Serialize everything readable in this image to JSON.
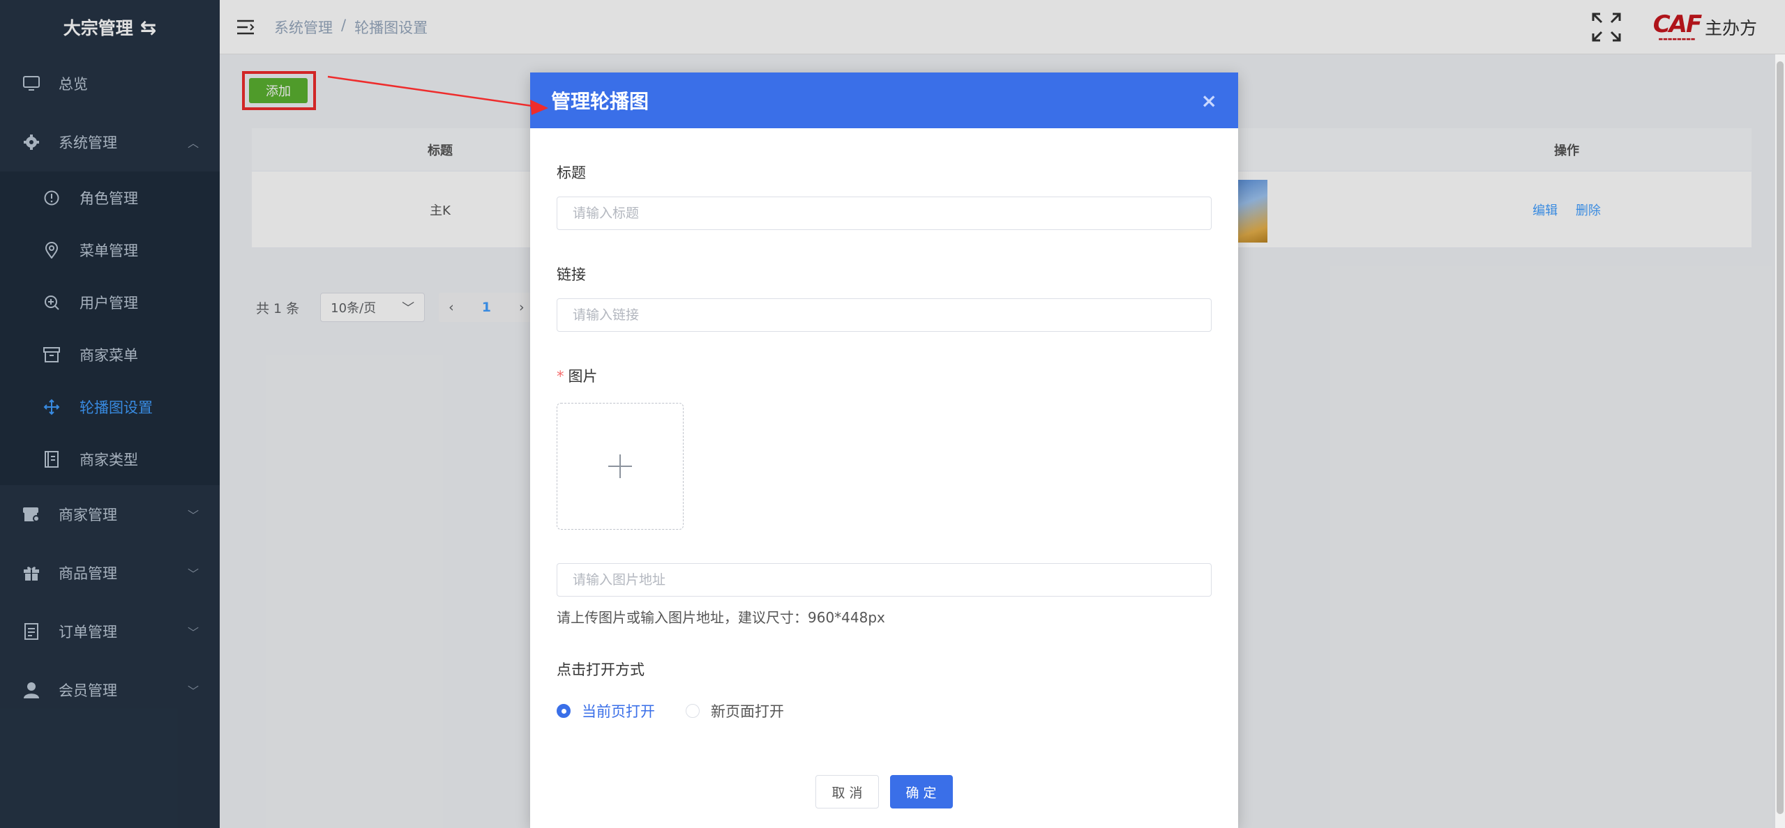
{
  "sidebar": {
    "logo_title": "大宗管理",
    "items": [
      {
        "label": "总览"
      },
      {
        "label": "系统管理"
      },
      {
        "label": "商家管理"
      },
      {
        "label": "商品管理"
      },
      {
        "label": "订单管理"
      },
      {
        "label": "会员管理"
      }
    ],
    "sub_items": [
      {
        "label": "角色管理"
      },
      {
        "label": "菜单管理"
      },
      {
        "label": "用户管理"
      },
      {
        "label": "商家菜单"
      },
      {
        "label": "轮播图设置"
      },
      {
        "label": "商家类型"
      }
    ],
    "active_color": "#409eff"
  },
  "header": {
    "breadcrumb": [
      "系统管理",
      "/",
      "轮播图设置"
    ],
    "logo_text": "CAF",
    "org_name": "主办方"
  },
  "content": {
    "add_label": "添加",
    "table": {
      "columns": [
        "标题",
        "操作"
      ],
      "rows": [
        {
          "title": "主K",
          "edit": "编辑",
          "delete": "删除"
        }
      ]
    },
    "pagination": {
      "total": "共 1 条",
      "page_size": "10条/页",
      "current": "1"
    }
  },
  "dialog": {
    "title": "管理轮播图",
    "close_icon": "×",
    "fields": {
      "title_label": "标题",
      "title_placeholder": "请输入标题",
      "link_label": "链接",
      "link_placeholder": "请输入链接",
      "image_label": "图片",
      "image_required": "*",
      "image_url_placeholder": "请输入图片地址",
      "image_hint": "请上传图片或输入图片地址，建议尺寸：960*448px",
      "open_label": "点击打开方式",
      "open_options": [
        "当前页打开",
        "新页面打开"
      ]
    },
    "cancel_label": "取 消",
    "confirm_label": "确 定",
    "accent": "#3a6fe8"
  }
}
